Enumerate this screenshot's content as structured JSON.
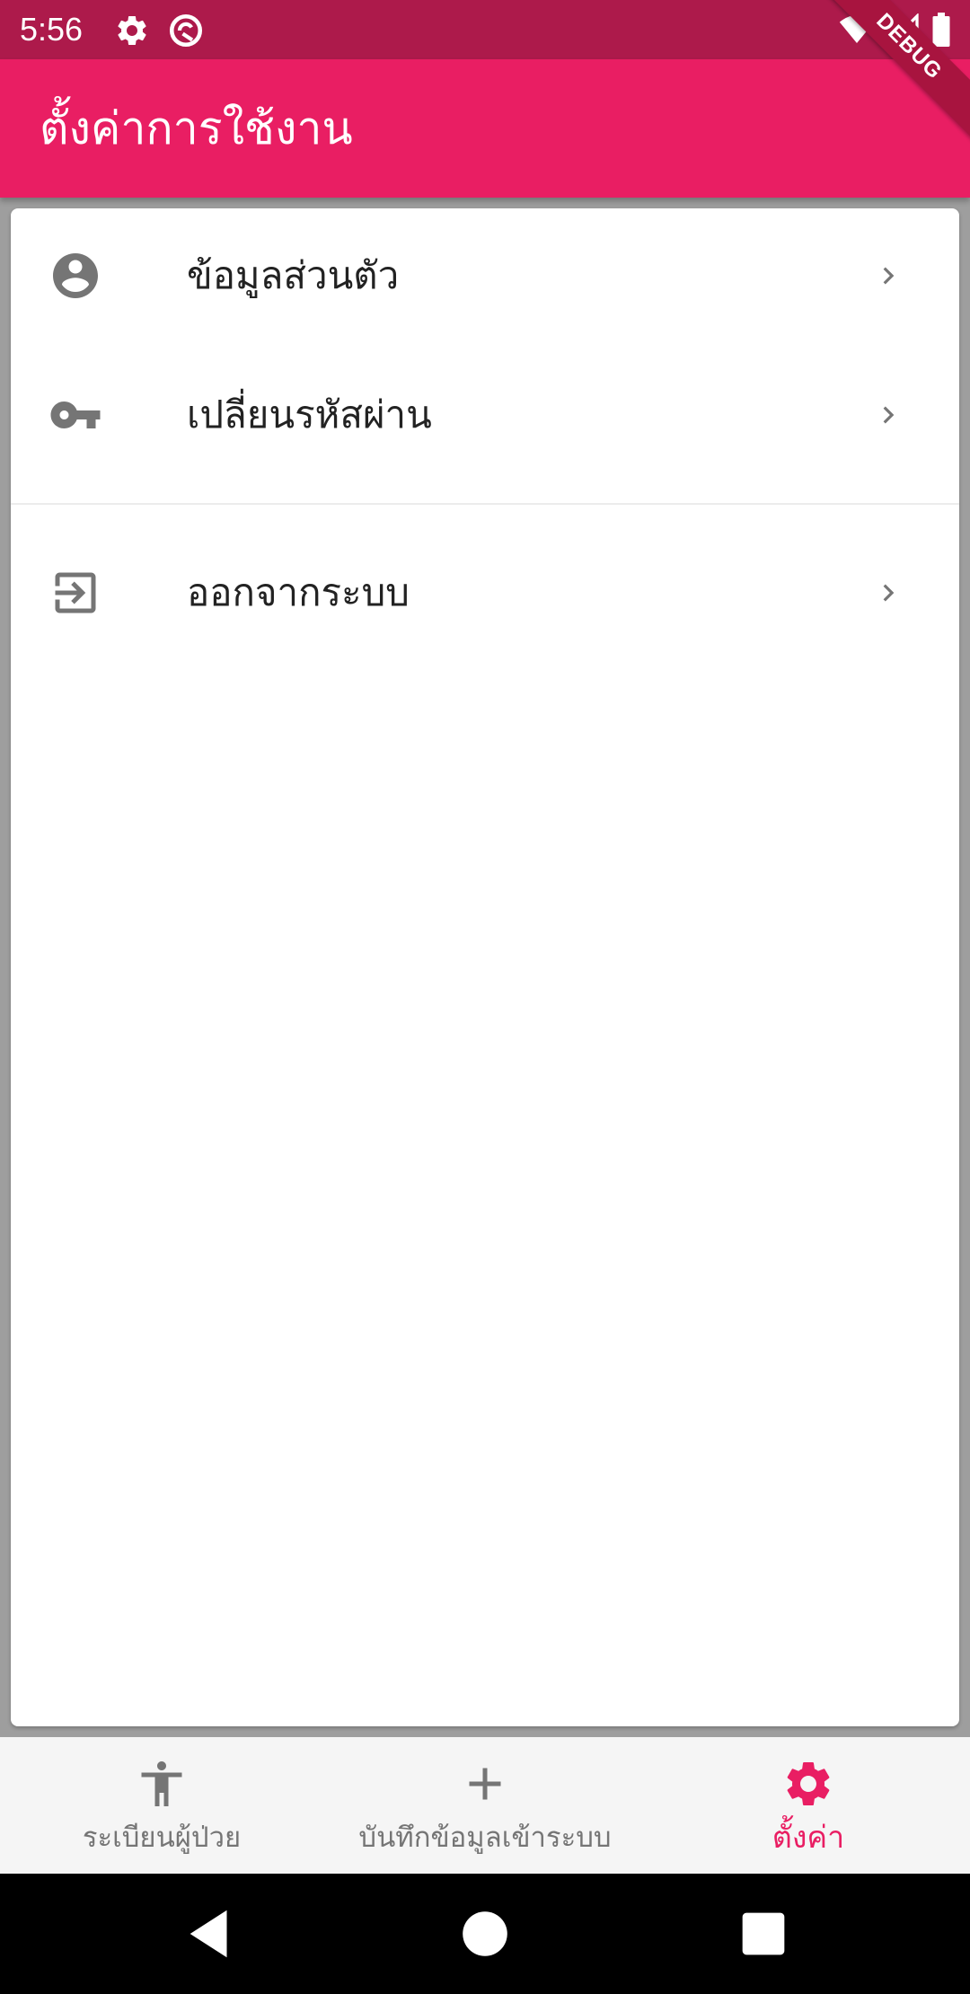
{
  "status_bar": {
    "time": "5:56",
    "background": "#ad1a4b"
  },
  "debug_banner": "DEBUG",
  "app_bar": {
    "title": "ตั้งค่าการใช้งาน",
    "background": "#e91e63"
  },
  "settings": {
    "items": [
      {
        "label": "ข้อมูลส่วนตัว",
        "icon": "account-circle-icon"
      },
      {
        "label": "เปลี่ยนรหัสผ่าน",
        "icon": "key-icon"
      },
      {
        "label": "ออกจากระบบ",
        "icon": "exit-icon"
      }
    ]
  },
  "bottom_nav": {
    "items": [
      {
        "label": "ระเบียนผู้ป่วย",
        "icon": "accessibility-icon",
        "active": false
      },
      {
        "label": "บันทึกข้อมูลเข้าระบบ",
        "icon": "add-icon",
        "active": false
      },
      {
        "label": "ตั้งค่า",
        "icon": "settings-gear-icon",
        "active": true
      }
    ],
    "active_color": "#e91e63",
    "inactive_color": "#757575"
  }
}
